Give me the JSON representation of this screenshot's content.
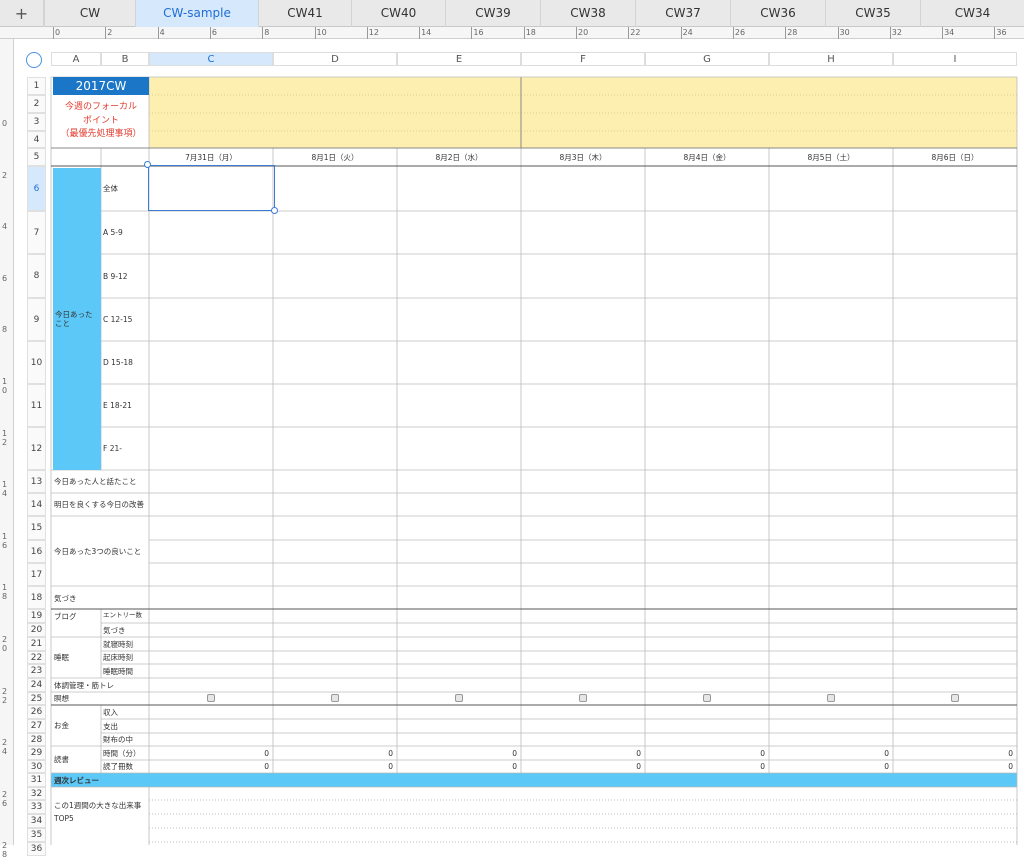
{
  "tabs": [
    "CW",
    "CW-sample",
    "CW41",
    "CW40",
    "CW39",
    "CW38",
    "CW37",
    "CW36",
    "CW35",
    "CW34"
  ],
  "active_tab": "CW-sample",
  "add_tab_symbol": "+",
  "hruler": [
    "0",
    "2",
    "4",
    "6",
    "8",
    "10",
    "12",
    "14",
    "16",
    "18",
    "20",
    "22",
    "24",
    "26",
    "28",
    "30",
    "32",
    "34",
    "36"
  ],
  "vruler": [
    "0",
    "2",
    "4",
    "6",
    "8",
    "10",
    "12",
    "14",
    "16",
    "18",
    "20",
    "22",
    "24",
    "26",
    "28"
  ],
  "columns": [
    "A",
    "B",
    "C",
    "D",
    "E",
    "F",
    "G",
    "H",
    "I"
  ],
  "title": "2017CW",
  "focal_label": "今週のフォーカル\nポイント\n（最優先処理事項）",
  "dates": [
    "7月31日（月）",
    "8月1日（火）",
    "8月2日（水）",
    "8月3日（木）",
    "8月4日（金）",
    "8月5日（土）",
    "8月6日（日）"
  ],
  "section_today": "今日あった\nこと",
  "time_slots": [
    "全体",
    "A 5-9",
    "B 9-12",
    "C 12-15",
    "D 15-18",
    "E 18-21",
    "F 21-"
  ],
  "rows": {
    "r13": "今日あった人と話たこと",
    "r14": "明日を良くする今日の改善",
    "r16": "今日あった3つの良いこと",
    "r18": "気づき",
    "blog": "ブログ",
    "blog_entries": "エントリー数",
    "blog_notes": "気づき",
    "sleep": "睡眠",
    "sleep_bed": "就寝時刻",
    "sleep_wake": "起床時刻",
    "sleep_hours": "睡眠時間",
    "health": "体調管理・筋トレ",
    "meditation": "瞑想",
    "money": "お金",
    "money_in": "収入",
    "money_out": "支出",
    "money_wallet": "財布の中",
    "reading": "読書",
    "reading_time": "時間（分）",
    "reading_books": "読了冊数",
    "weekly": "週次レビュー",
    "top5": "この1週間の大きな出来事\nTOP5"
  },
  "reading_zero": "0",
  "colors": {
    "title_bg": "#1b76c8",
    "cyan": "#5bc8f7",
    "yellow": "#fdefb0",
    "accent": "#1e6ed6",
    "red": "#e23b2e"
  }
}
